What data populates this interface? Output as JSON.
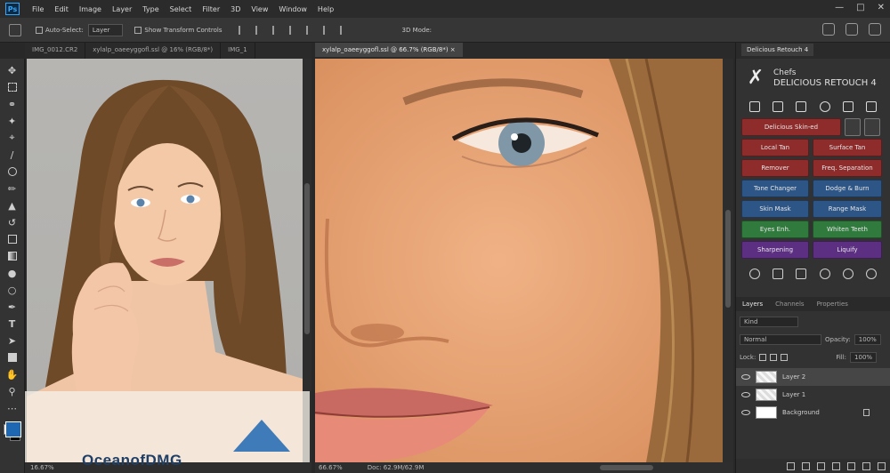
{
  "app": {
    "logo_text": "Ps"
  },
  "menu": [
    "File",
    "Edit",
    "Image",
    "Layer",
    "Type",
    "Select",
    "Filter",
    "3D",
    "View",
    "Window",
    "Help"
  ],
  "options_bar": {
    "auto_select_label": "Auto-Select:",
    "layer_select": "Layer",
    "transform_label": "Show Transform Controls",
    "mode_label": "3D Mode:"
  },
  "doc_tabs_left": [
    "IMG_0012.CR2",
    "xylalp_oaeeyggofl.ssl @ 16% (RGB/8*)",
    "IMG_1"
  ],
  "doc_tab_right": "xylalp_oaeeyggofl.ssl @ 66.7% (RGB/8*) ×",
  "status_left": {
    "zoom": "16.67%"
  },
  "status_right": {
    "zoom": "66.67%",
    "doc": "Doc: 62.9M/62.9M"
  },
  "retouch_panel": {
    "tab": "Delicious Retouch 4",
    "brand_line1": "Chefs",
    "brand_line2": "DELICIOUS RETOUCH 4",
    "buttons": {
      "delicious_skin": "Delicious Skin-ed",
      "local_tan": "Local Tan",
      "surface_tan": "Surface Tan",
      "remover": "Remover",
      "freq_separation": "Freq. Separation",
      "tone_changer": "Tone Changer",
      "dodge_burn": "Dodge & Burn",
      "skin_mask": "Skin Mask",
      "range_mask": "Range Mask",
      "eyes_enh": "Eyes Enh.",
      "whiten_teeth": "Whiten Teeth",
      "sharpening": "Sharpening",
      "liquify": "Liquify"
    }
  },
  "layers_panel": {
    "tabs": [
      "Layers",
      "Channels",
      "Properties"
    ],
    "filter": "Kind",
    "blend_mode": "Normal",
    "opacity_label": "Opacity:",
    "opacity_value": "100%",
    "lock_label": "Lock:",
    "fill_label": "Fill:",
    "fill_value": "100%",
    "layers": [
      {
        "name": "Layer 2"
      },
      {
        "name": "Layer 1"
      },
      {
        "name": "Background"
      }
    ]
  },
  "watermark": {
    "text": "OceanofDMG"
  }
}
